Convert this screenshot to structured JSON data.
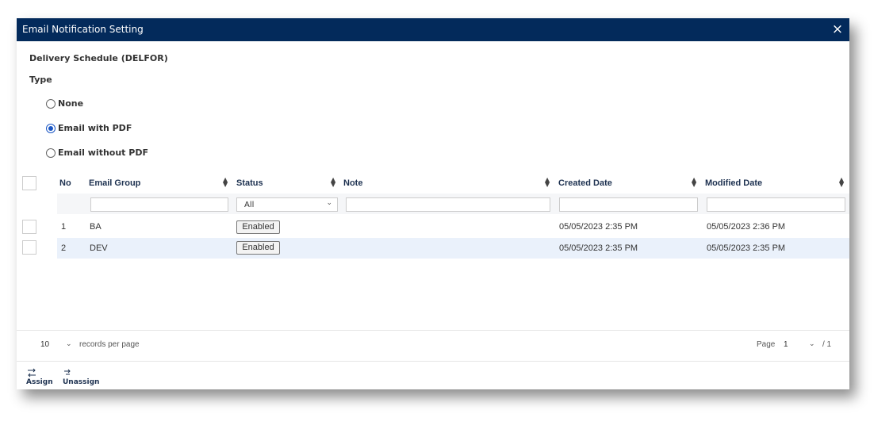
{
  "dialog": {
    "title": "Email Notification Setting",
    "close_glyph": "×"
  },
  "section_title": "Delivery Schedule (DELFOR)",
  "type_label": "Type",
  "type_options": [
    {
      "label": "None",
      "selected": false
    },
    {
      "label": "Email with PDF",
      "selected": true
    },
    {
      "label": "Email without PDF",
      "selected": false
    }
  ],
  "table": {
    "columns": {
      "no": "No",
      "email_group": "Email Group",
      "status": "Status",
      "note": "Note",
      "created": "Created Date",
      "modified": "Modified Date"
    },
    "status_filter_value": "All",
    "rows": [
      {
        "no": "1",
        "email_group": "BA",
        "status": "Enabled",
        "note": "",
        "created": "05/05/2023 2:35 PM",
        "modified": "05/05/2023 2:36 PM"
      },
      {
        "no": "2",
        "email_group": "DEV",
        "status": "Enabled",
        "note": "",
        "created": "05/05/2023 2:35 PM",
        "modified": "05/05/2023 2:35 PM"
      }
    ]
  },
  "pager": {
    "page_size": "10",
    "per_page_text": "records per page",
    "page_label": "Page",
    "page_value": "1",
    "total": "/ 1"
  },
  "toolbar": {
    "assign": "Assign",
    "unassign": "Unassign"
  }
}
